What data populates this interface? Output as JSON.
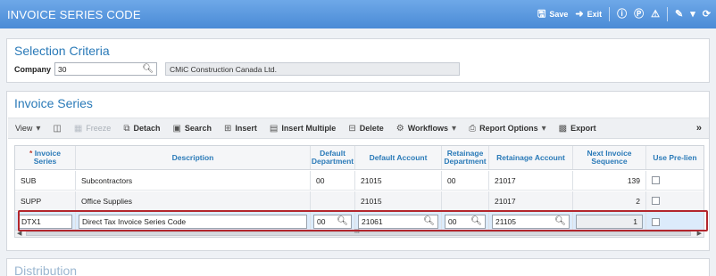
{
  "title_bar": {
    "title": "INVOICE SERIES CODE",
    "save_label": "Save",
    "exit_label": "Exit"
  },
  "selection": {
    "heading": "Selection Criteria",
    "company_label": "Company",
    "company_value": "30",
    "company_name": "CMiC Construction Canada Ltd."
  },
  "invoice": {
    "heading": "Invoice Series",
    "toolbar": {
      "view": "View",
      "freeze": "Freeze",
      "detach": "Detach",
      "search": "Search",
      "insert": "Insert",
      "insert_multiple": "Insert Multiple",
      "delete": "Delete",
      "workflows": "Workflows",
      "report_options": "Report Options",
      "export": "Export",
      "more": "»"
    },
    "columns": {
      "series_req": "* ",
      "series": "Invoice Series",
      "description": "Description",
      "default_department": "Default Department",
      "default_account": "Default Account",
      "retainage_department": "Retainage Department",
      "retainage_account": "Retainage Account",
      "next_sequence": "Next Invoice Sequence",
      "use_prelien": "Use Pre-lien"
    },
    "rows": [
      {
        "series": "SUB",
        "description": "Subcontractors",
        "dept": "00",
        "account": "21015",
        "ret_dept": "00",
        "ret_account": "21017",
        "next_seq": "139"
      },
      {
        "series": "SUPP",
        "description": "Office Supplies",
        "dept": "",
        "account": "21015",
        "ret_dept": "",
        "ret_account": "21017",
        "next_seq": "2"
      },
      {
        "series": "DTX1",
        "description": "Direct Tax Invoice Series Code",
        "dept": "00",
        "account": "21061",
        "ret_dept": "00",
        "ret_account": "21105",
        "next_seq": "1"
      }
    ],
    "scroll_grip": "III"
  },
  "distribution": {
    "heading": "Distribution"
  },
  "colors": {
    "title_bar": "#4a8bd6",
    "heading": "#2a7ab8",
    "selected_row": "#dcebfb",
    "selection_border": "#b3262d"
  }
}
